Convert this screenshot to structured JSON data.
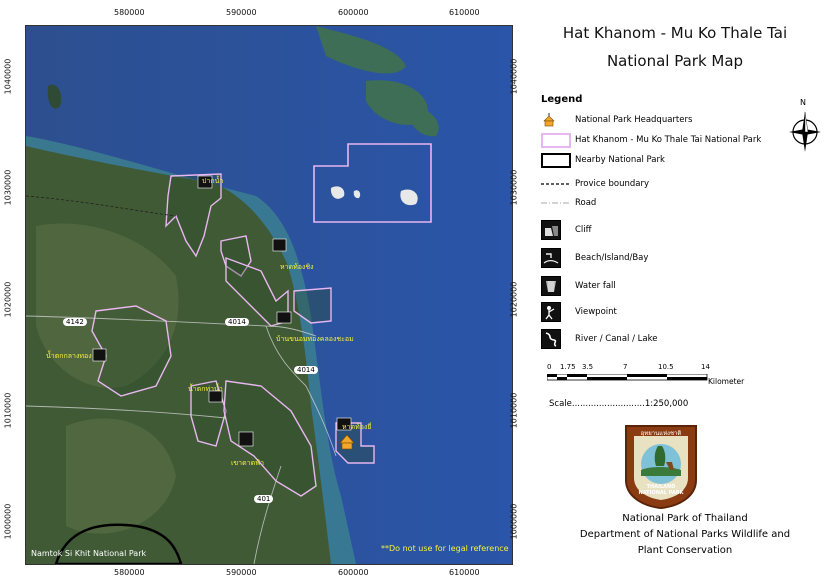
{
  "map": {
    "title_line1": "Hat Khanom - Mu Ko Thale Tai",
    "title_line2": "National Park Map",
    "x_ticks": [
      "580000",
      "590000",
      "600000",
      "610000"
    ],
    "y_ticks": [
      "1040000",
      "1030000",
      "1020000",
      "1010000",
      "1000000"
    ],
    "place_labels": {
      "nam_tok_klang": "น้ำตกกลางทอง",
      "nam_tok_mai": "น้ำตกท่าน้ำ",
      "khao_dat_fa": "เขาดาดฟ้า",
      "ao_thong_yi": "หาดท้องยี่",
      "hat_nai_phlao": "หาดท้องชิง",
      "lak_nam": "ปากน้ำ",
      "hat_khanom_bay": "บ้านขนอมทองคลองชะอม"
    },
    "road_numbers": [
      "4142",
      "4014",
      "4014",
      "401"
    ],
    "disclaimer": "**Do not use for legal reference",
    "nearby_park_label": "Namtok Si Khit National Park"
  },
  "legend": {
    "heading": "Legend",
    "items": [
      {
        "label": "National Park Headquarters",
        "icon": "headquarters-icon"
      },
      {
        "label": "Hat Khanom - Mu Ko Thale Tai National Park",
        "icon": "park-boundary-swatch"
      },
      {
        "label": "Nearby National Park",
        "icon": "nearby-park-swatch"
      },
      {
        "label": "Provice boundary",
        "icon": "province-line"
      },
      {
        "label": "Road",
        "icon": "road-line"
      },
      {
        "label": "Cliff",
        "icon": "cliff-icon"
      },
      {
        "label": "Beach/Island/Bay",
        "icon": "beach-icon"
      },
      {
        "label": "Water fall",
        "icon": "waterfall-icon"
      },
      {
        "label": "Viewpoint",
        "icon": "viewpoint-icon"
      },
      {
        "label": "River / Canal / Lake",
        "icon": "river-icon"
      }
    ],
    "north_label": "N"
  },
  "scale": {
    "ticks": [
      "0",
      "1.75",
      "3.5",
      "7",
      "10.5",
      "14"
    ],
    "unit": "Kilometer",
    "text": "Scale...........................1:250,000"
  },
  "footer": {
    "line1": "National Park of Thailand",
    "line2": "Department of National Parks Wildlife and",
    "line3": "Plant Conservation",
    "logo_text_top": "อุทยานแห่งชาติ",
    "logo_text_curve": "NATIONAL PARK",
    "logo_text_bottom": "THAILAND"
  },
  "colors": {
    "sea": "#2f5aa0",
    "sea_shallow": "#3a8a9a",
    "land": "#3d5a34",
    "land_light": "#6f7f5a",
    "park_border": "#e8b6f0",
    "label_yellow": "#f5f23a",
    "headquarters": "#f2a62a"
  }
}
